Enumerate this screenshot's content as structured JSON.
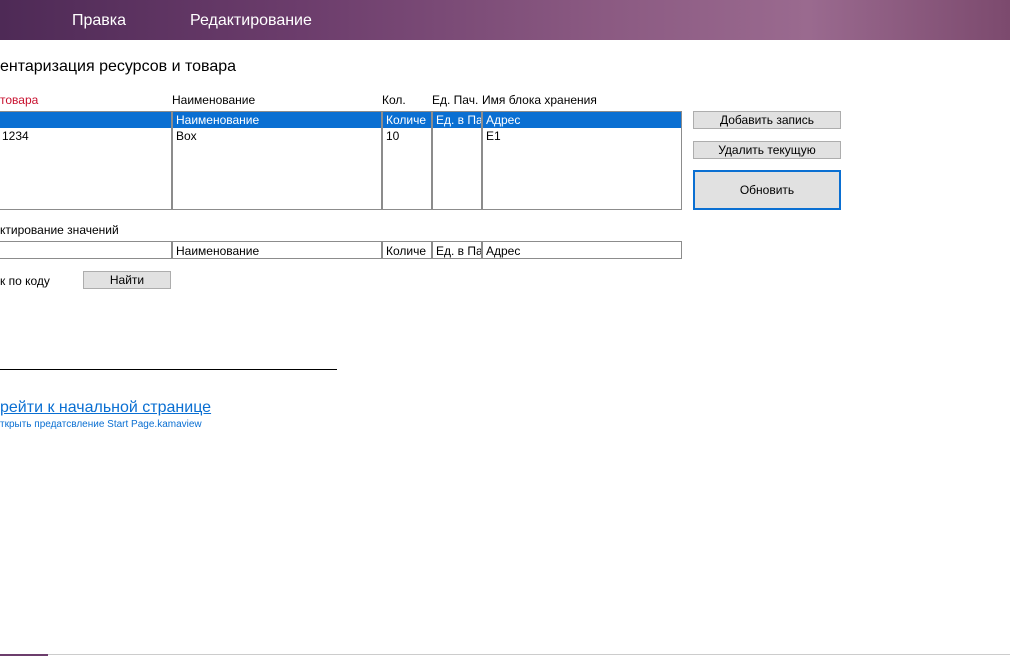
{
  "menu": {
    "items": [
      {
        "label": "Правка"
      },
      {
        "label": "Редактирование"
      }
    ]
  },
  "page": {
    "title": "ентаризация ресурсов и товара"
  },
  "list": {
    "headers": {
      "code": "товара",
      "name": "Наименование",
      "qty": "Кол.",
      "unit": "Ед. Пач.",
      "block": "Имя блока хранения"
    },
    "rows": [
      {
        "code": "",
        "name": "Наименование",
        "qty": "Количе",
        "unit": "Ед. в Па",
        "block": "Адрес",
        "selected": true
      },
      {
        "code": "1234",
        "name": "Box",
        "qty": "10",
        "unit": "",
        "block": "E1",
        "selected": false
      }
    ]
  },
  "buttons": {
    "add": "Добавить запись",
    "delete": "Удалить текущую",
    "refresh": "Обновить",
    "find": "Найти"
  },
  "edit": {
    "label": "ктирование значений",
    "code": "",
    "name": "Наименование",
    "qty": "Количе",
    "unit": "Ед. в Па",
    "block": "Адрес"
  },
  "search": {
    "label": "к по коду"
  },
  "links": {
    "home": "рейти к начальной странице",
    "home_sub": "ткрыть предатсвление Start Page.kamaview"
  },
  "colors": {
    "accent": "#0a6fd2",
    "header_red": "#c8102e",
    "menubar": "#7a4a73"
  }
}
